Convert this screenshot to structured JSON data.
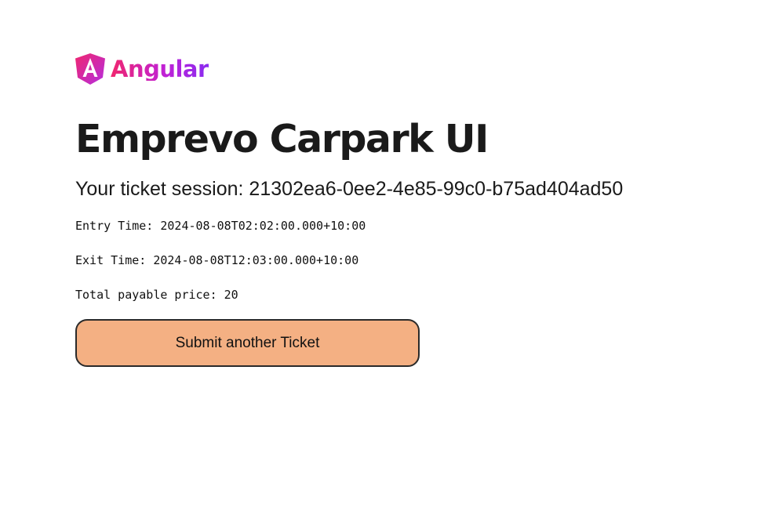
{
  "brand": {
    "name": "Angular",
    "icon": "angular-shield-icon",
    "colors": {
      "shield_start": "#f0266e",
      "shield_end": "#b52ee0",
      "text_start": "#f0266e",
      "text_end": "#8a2cf0"
    }
  },
  "page": {
    "title": "Emprevo Carpark UI",
    "session_label": "Your ticket session:",
    "session_id": "21302ea6-0ee2-4e85-99c0-b75ad404ad50"
  },
  "ticket": {
    "entry_label": "Entry Time:",
    "entry_time": "2024-08-08T02:02:00.000+10:00",
    "exit_label": "Exit Time:",
    "exit_time": "2024-08-08T12:03:00.000+10:00",
    "price_label": "Total payable price:",
    "price": "20"
  },
  "actions": {
    "submit_another_label": "Submit another Ticket",
    "button_color": "#f4b083"
  }
}
